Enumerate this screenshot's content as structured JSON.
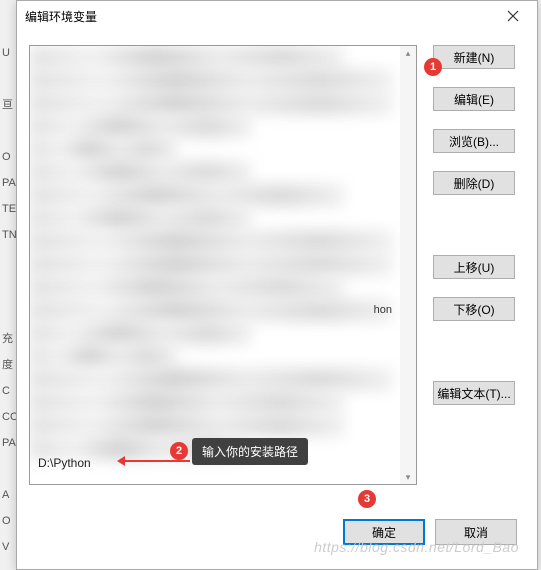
{
  "bg": {
    "labels": [
      "U",
      "",
      "亘",
      "",
      "O",
      "PA",
      "TE",
      "TN",
      "",
      "",
      "",
      "充",
      "度",
      "C",
      "CO",
      "PA",
      "",
      "A",
      "O",
      "V"
    ]
  },
  "dialog": {
    "title": "编辑环境变量",
    "visible_row_fragment": "hon",
    "input_value": "D:\\Python"
  },
  "buttons": {
    "new": "新建(N)",
    "edit": "编辑(E)",
    "browse": "浏览(B)...",
    "delete": "删除(D)",
    "move_up": "上移(U)",
    "move_down": "下移(O)",
    "edit_text": "编辑文本(T)...",
    "ok": "确定",
    "cancel": "取消"
  },
  "annotations": {
    "badge1": "1",
    "badge2": "2",
    "badge3": "3",
    "tooltip": "输入你的安装路径"
  },
  "watermark": "https://blog.csdn.net/Lord_Bao"
}
